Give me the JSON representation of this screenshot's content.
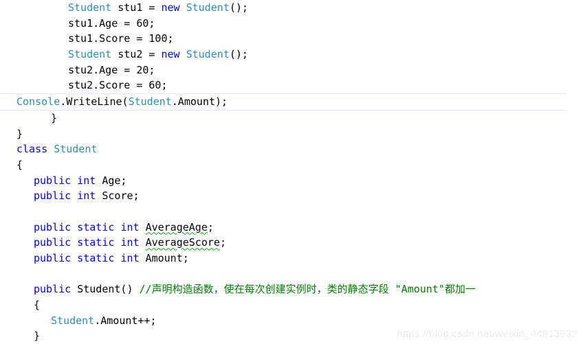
{
  "editor": {
    "language": "csharp",
    "colors": {
      "background": "#ffffff",
      "plain_text": "#000000",
      "keyword": "#0000ff",
      "type": "#2b91af",
      "comment": "#008000",
      "warning_squiggle": "#12a112",
      "current_line_border": "#e8e8f2",
      "watermark": "#ececec"
    },
    "lines": [
      {
        "n": 1,
        "indent": 3,
        "text": "Student stu1 = new Student();",
        "tokens": [
          {
            "t": "Student",
            "c": "type"
          },
          {
            "t": " stu1 = ",
            "c": "pln"
          },
          {
            "t": "new",
            "c": "kw"
          },
          {
            "t": " ",
            "c": "pln"
          },
          {
            "t": "Student",
            "c": "type"
          },
          {
            "t": "();",
            "c": "pln"
          }
        ]
      },
      {
        "n": 2,
        "indent": 3,
        "text": "stu1.Age = 60;",
        "tokens": [
          {
            "t": "stu1.Age = 60;",
            "c": "pln"
          }
        ]
      },
      {
        "n": 3,
        "indent": 3,
        "text": "stu1.Score = 100;",
        "tokens": [
          {
            "t": "stu1.Score = 100;",
            "c": "pln"
          }
        ]
      },
      {
        "n": 4,
        "indent": 3,
        "text": "Student stu2 = new Student();",
        "tokens": [
          {
            "t": "Student",
            "c": "type"
          },
          {
            "t": " stu2 = ",
            "c": "pln"
          },
          {
            "t": "new",
            "c": "kw"
          },
          {
            "t": " ",
            "c": "pln"
          },
          {
            "t": "Student",
            "c": "type"
          },
          {
            "t": "();",
            "c": "pln"
          }
        ]
      },
      {
        "n": 5,
        "indent": 3,
        "text": "stu2.Age = 20;",
        "tokens": [
          {
            "t": "stu2.Age = 20;",
            "c": "pln"
          }
        ]
      },
      {
        "n": 6,
        "indent": 3,
        "text": "stu2.Score = 60;",
        "tokens": [
          {
            "t": "stu2.Score = 60;",
            "c": "pln"
          }
        ]
      },
      {
        "n": 7,
        "indent": 3,
        "current": true,
        "text": "Console.WriteLine(Student.Amount);",
        "tokens": [
          {
            "t": "Console",
            "c": "type"
          },
          {
            "t": ".WriteLine(",
            "c": "pln"
          },
          {
            "t": "Student",
            "c": "type"
          },
          {
            "t": ".Amount);",
            "c": "pln"
          }
        ]
      },
      {
        "n": 8,
        "indent": 2,
        "text": "}",
        "tokens": [
          {
            "t": "}",
            "c": "pln"
          }
        ]
      },
      {
        "n": 9,
        "indent": 0,
        "text": "}",
        "tokens": [
          {
            "t": "}",
            "c": "pln"
          }
        ]
      },
      {
        "n": 10,
        "indent": 0,
        "text": "class Student",
        "tokens": [
          {
            "t": "class",
            "c": "kw"
          },
          {
            "t": " ",
            "c": "pln"
          },
          {
            "t": "Student",
            "c": "type"
          }
        ]
      },
      {
        "n": 11,
        "indent": 0,
        "text": "{",
        "tokens": [
          {
            "t": "{",
            "c": "pln"
          }
        ]
      },
      {
        "n": 12,
        "indent": 1,
        "text": "public int Age;",
        "tokens": [
          {
            "t": "public",
            "c": "kw"
          },
          {
            "t": " ",
            "c": "pln"
          },
          {
            "t": "int",
            "c": "kw"
          },
          {
            "t": " Age;",
            "c": "pln"
          }
        ]
      },
      {
        "n": 13,
        "indent": 1,
        "text": "public int Score;",
        "tokens": [
          {
            "t": "public",
            "c": "kw"
          },
          {
            "t": " ",
            "c": "pln"
          },
          {
            "t": "int",
            "c": "kw"
          },
          {
            "t": " Score;",
            "c": "pln"
          }
        ]
      },
      {
        "n": 14,
        "indent": 0,
        "text": "",
        "tokens": []
      },
      {
        "n": 15,
        "indent": 1,
        "text": "public static int AverageAge;",
        "tokens": [
          {
            "t": "public",
            "c": "kw"
          },
          {
            "t": " ",
            "c": "pln"
          },
          {
            "t": "static",
            "c": "kw"
          },
          {
            "t": " ",
            "c": "pln"
          },
          {
            "t": "int",
            "c": "kw"
          },
          {
            "t": " ",
            "c": "pln"
          },
          {
            "t": "AverageAge",
            "c": "pln",
            "squiggle": true
          },
          {
            "t": ";",
            "c": "pln"
          }
        ]
      },
      {
        "n": 16,
        "indent": 1,
        "text": "public static int AverageScore;",
        "tokens": [
          {
            "t": "public",
            "c": "kw"
          },
          {
            "t": " ",
            "c": "pln"
          },
          {
            "t": "static",
            "c": "kw"
          },
          {
            "t": " ",
            "c": "pln"
          },
          {
            "t": "int",
            "c": "kw"
          },
          {
            "t": " ",
            "c": "pln"
          },
          {
            "t": "AverageScore",
            "c": "pln",
            "squiggle": true
          },
          {
            "t": ";",
            "c": "pln"
          }
        ]
      },
      {
        "n": 17,
        "indent": 1,
        "text": "public static int Amount;",
        "tokens": [
          {
            "t": "public",
            "c": "kw"
          },
          {
            "t": " ",
            "c": "pln"
          },
          {
            "t": "static",
            "c": "kw"
          },
          {
            "t": " ",
            "c": "pln"
          },
          {
            "t": "int",
            "c": "kw"
          },
          {
            "t": " Amount;",
            "c": "pln"
          }
        ]
      },
      {
        "n": 18,
        "indent": 0,
        "text": "",
        "tokens": []
      },
      {
        "n": 19,
        "indent": 1,
        "text": "public Student() //声明构造函数，使在每次创建实例时，类的静态字段 \"Amount\"都加一",
        "tokens": [
          {
            "t": "public",
            "c": "kw"
          },
          {
            "t": " Student() ",
            "c": "pln"
          },
          {
            "t": "//声明构造函数，使在每次创建实例时，类的静态字段 \"Amount\"都加一",
            "c": "cmt"
          }
        ]
      },
      {
        "n": 20,
        "indent": 1,
        "text": "{",
        "tokens": [
          {
            "t": "{",
            "c": "pln"
          }
        ]
      },
      {
        "n": 21,
        "indent": 2,
        "text": "Student.Amount++;",
        "tokens": [
          {
            "t": "Student",
            "c": "type"
          },
          {
            "t": ".Amount++;",
            "c": "pln"
          }
        ]
      },
      {
        "n": 22,
        "indent": 1,
        "text": "}",
        "tokens": [
          {
            "t": "}",
            "c": "pln"
          }
        ]
      }
    ]
  },
  "watermark": {
    "text": "https://blog.csdn.net/weixin_44813932"
  }
}
